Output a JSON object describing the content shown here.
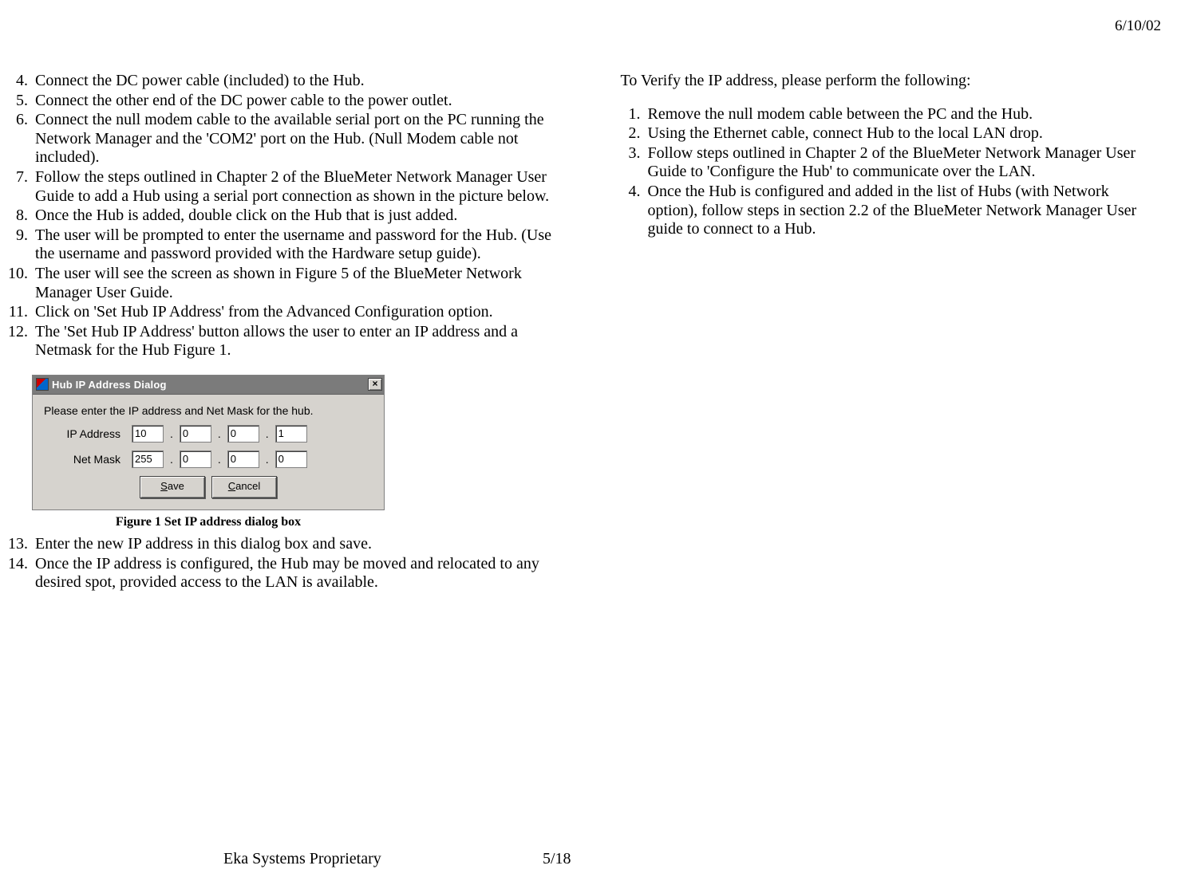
{
  "header": {
    "date": "6/10/02"
  },
  "left": {
    "start": 4,
    "items": [
      "Connect the DC power cable (included) to the Hub.",
      "Connect the other end of the DC power cable to the power outlet.",
      "Connect the null modem cable to the available serial port on the PC running the Network Manager and the 'COM2' port on the Hub. (Null Modem cable not included).",
      "Follow the steps outlined in Chapter 2 of the BlueMeter Network Manager User Guide to add a Hub using a serial port connection as shown in the picture below.",
      "Once the Hub is added, double click on the Hub that is just added.",
      "The user will be prompted to enter the username and password for the Hub. (Use the username and password provided with the Hardware setup guide).",
      "The user will see the screen as shown in Figure 5 of the BlueMeter Network Manager User Guide.",
      "Click on 'Set Hub IP Address' from the Advanced Configuration option.",
      "The 'Set Hub IP Address' button allows the user to enter an IP address and a Netmask for the Hub Figure 1."
    ],
    "resume_start": 13,
    "resume_items": [
      "Enter the new IP address in this dialog box and save.",
      "Once the IP address is configured, the Hub may be moved and relocated to any desired spot, provided access to the LAN is available."
    ]
  },
  "right": {
    "intro": "To Verify the IP address, please perform the following:",
    "items": [
      "Remove the null modem cable between the PC and the Hub.",
      "Using the Ethernet cable, connect Hub to the local LAN drop.",
      "Follow steps outlined in Chapter 2 of the BlueMeter Network Manager User Guide to 'Configure the Hub' to communicate over the LAN.",
      "Once the Hub is configured and added in the list of Hubs (with Network option), follow steps in section 2.2 of the BlueMeter Network Manager User guide to connect to a Hub."
    ]
  },
  "dialog": {
    "title": "Hub IP Address Dialog",
    "close_glyph": "×",
    "prompt": "Please enter the IP address and Net Mask for the hub.",
    "rows": {
      "ip": {
        "label": "IP Address",
        "octets": [
          "10",
          "0",
          "0",
          "1"
        ]
      },
      "mask": {
        "label": "Net Mask",
        "octets": [
          "255",
          "0",
          "0",
          "0"
        ]
      }
    },
    "buttons": {
      "save": "Save",
      "cancel": "Cancel"
    },
    "caption": "Figure 1 Set IP address dialog box"
  },
  "footer": {
    "center": "Eka Systems Proprietary",
    "page": "5/18"
  }
}
